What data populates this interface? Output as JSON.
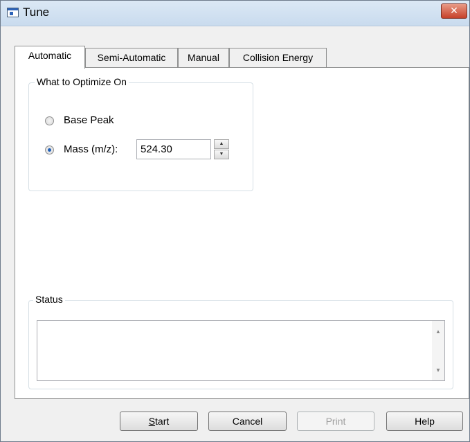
{
  "window": {
    "title": "Tune",
    "close_label": "✕"
  },
  "tabs": [
    {
      "label": "Automatic",
      "active": true
    },
    {
      "label": "Semi-Automatic",
      "active": false
    },
    {
      "label": "Manual",
      "active": false
    },
    {
      "label": "Collision Energy",
      "active": false
    }
  ],
  "optimize": {
    "group_label": "What to Optimize On",
    "base_peak_label": "Base Peak",
    "base_peak_selected": false,
    "mass_label": "Mass (m/z):",
    "mass_selected": true,
    "mass_value": "524.30"
  },
  "status": {
    "group_label": "Status",
    "text": ""
  },
  "buttons": {
    "start_accel": "S",
    "start_rest": "tart",
    "cancel": "Cancel",
    "print": "Print",
    "help": "Help"
  }
}
